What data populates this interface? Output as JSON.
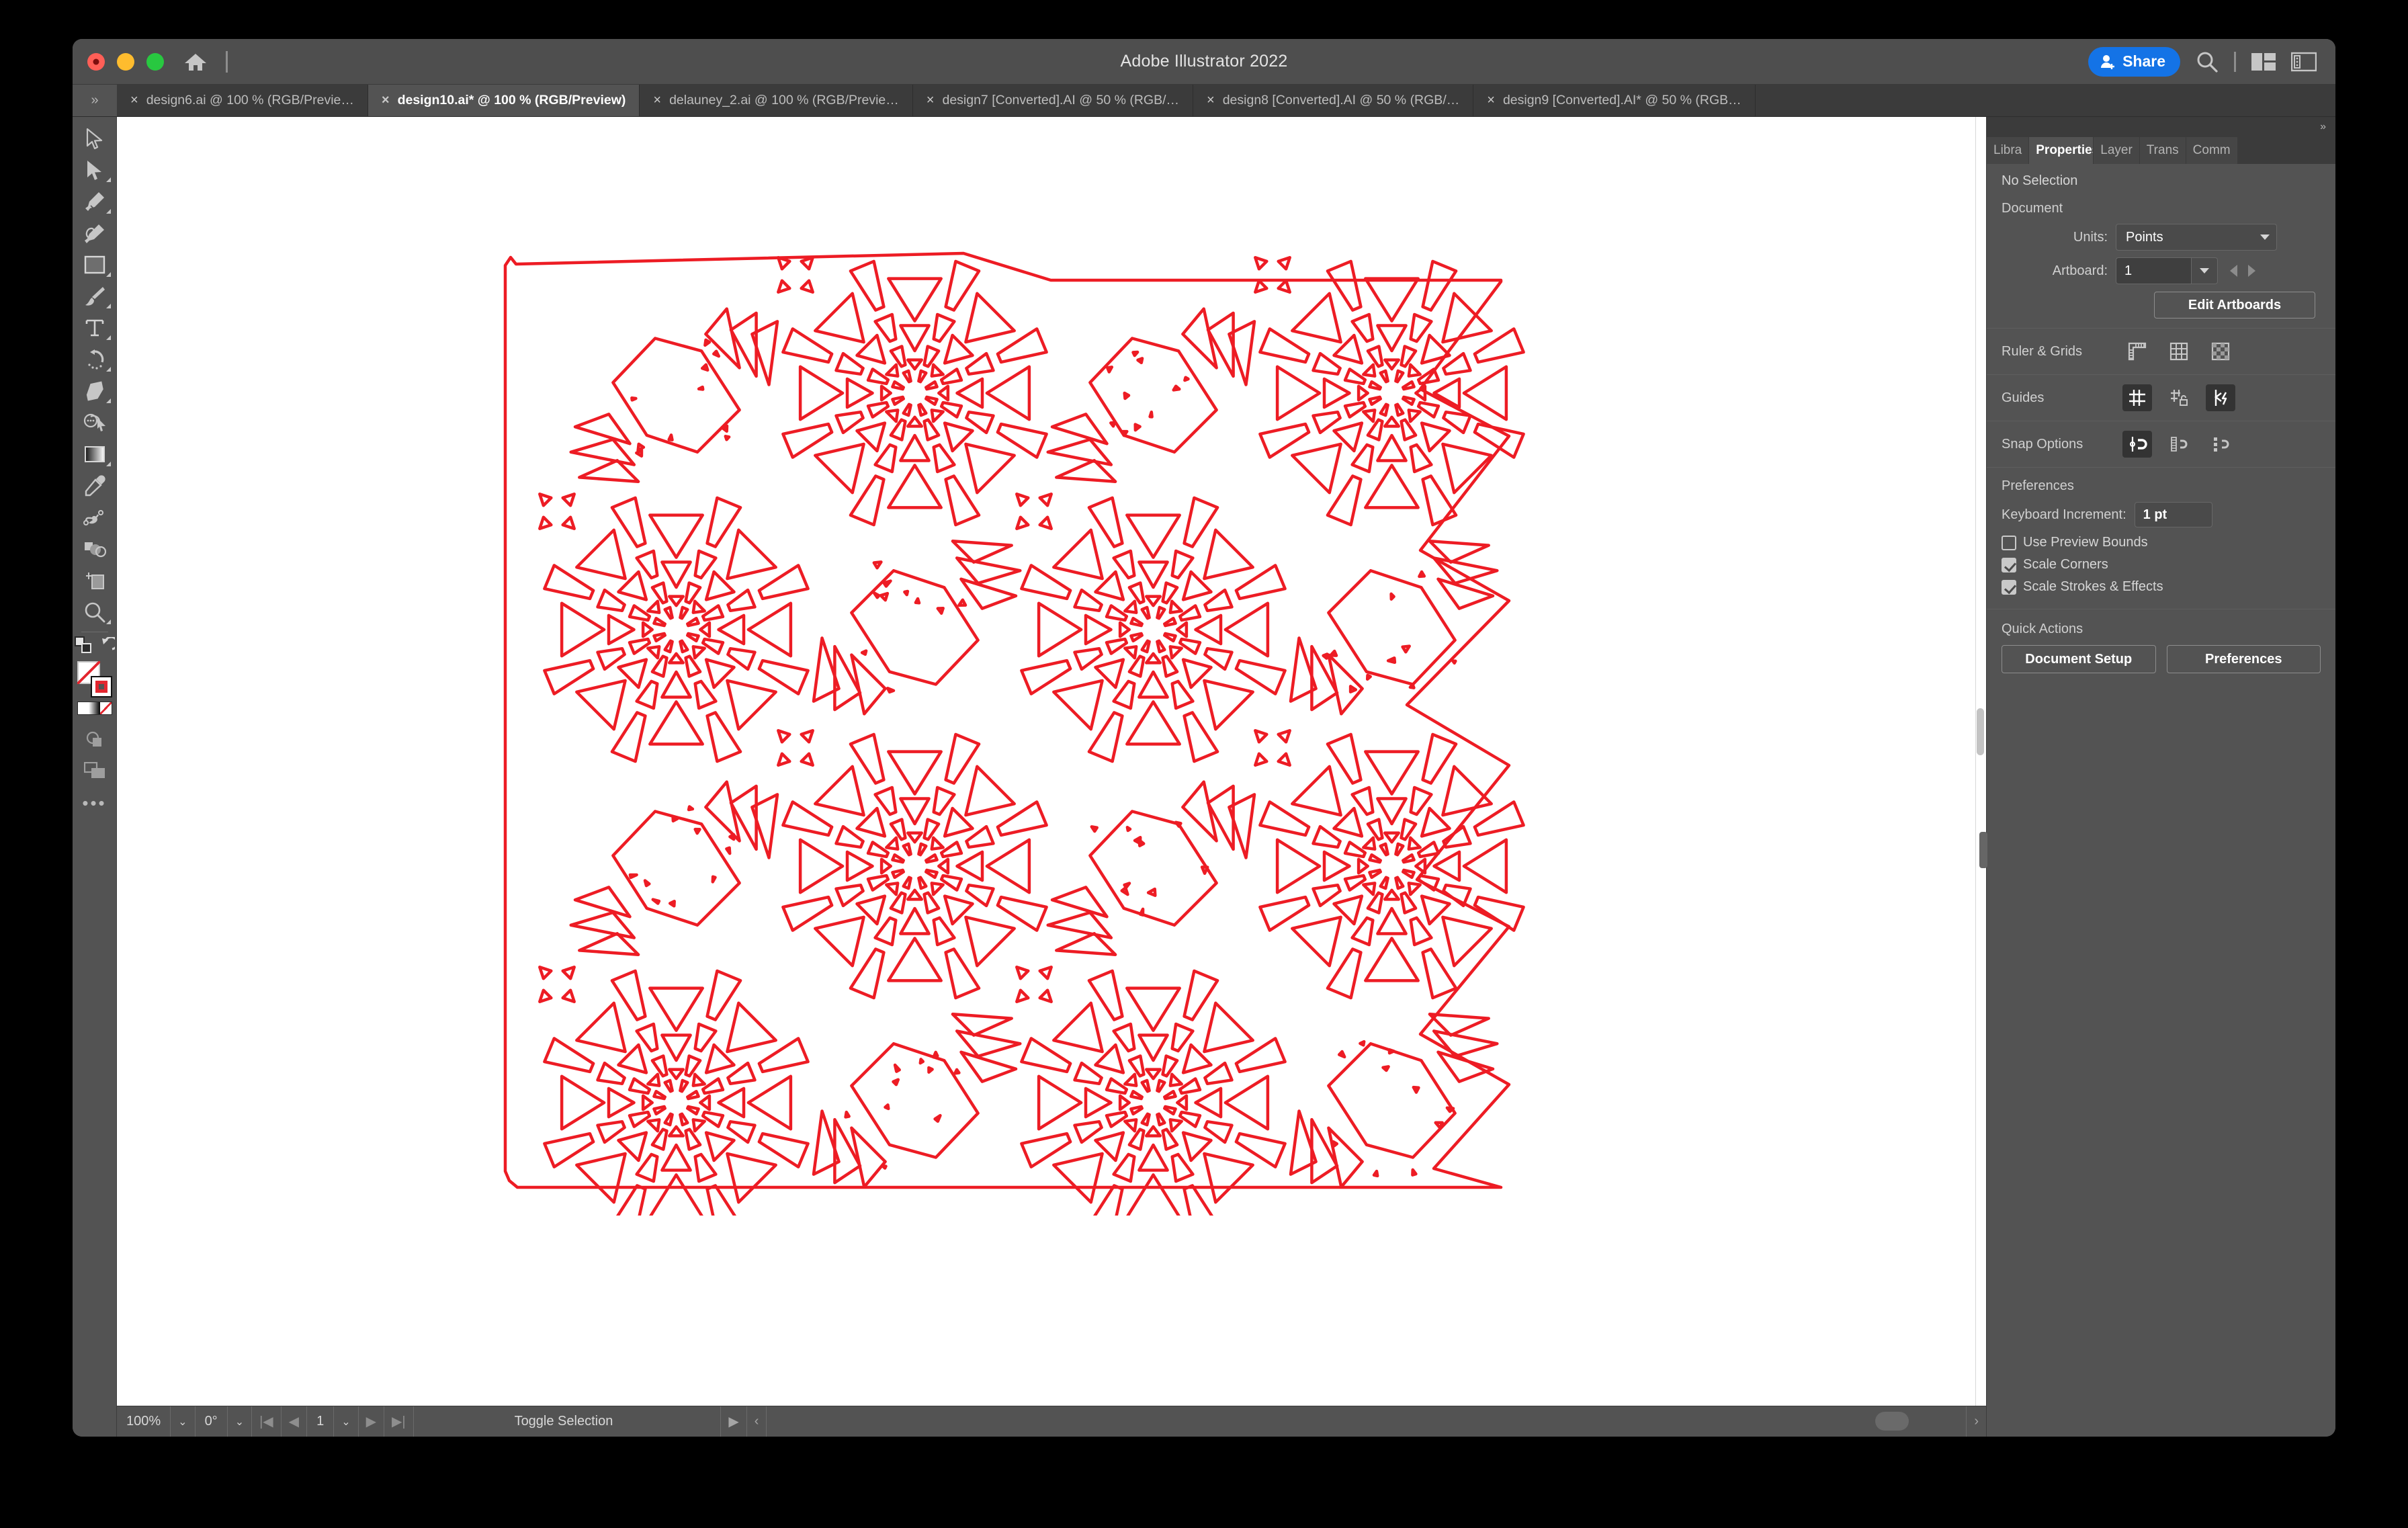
{
  "window": {
    "app_title": "Adobe Illustrator 2022",
    "traffic_lights": [
      "close",
      "minimize",
      "zoom"
    ],
    "home_icon": "home-icon",
    "share_label": "Share",
    "search_icon": "search-icon",
    "arrange_icon": "arrange-documents-icon",
    "workspace_icon": "workspace-switcher-icon"
  },
  "tabbar": {
    "overflow_left": "»",
    "tabs": [
      {
        "label": "design6.ai @ 100 % (RGB/Previe…",
        "close": "×",
        "active": false
      },
      {
        "label": "design10.ai* @ 100 % (RGB/Preview)",
        "close": "×",
        "active": true
      },
      {
        "label": "delauney_2.ai @ 100 % (RGB/Previe…",
        "close": "×",
        "active": false
      },
      {
        "label": "design7 [Converted].AI @ 50 % (RGB/…",
        "close": "×",
        "active": false
      },
      {
        "label": "design8 [Converted].AI @ 50 % (RGB/…",
        "close": "×",
        "active": false
      },
      {
        "label": "design9 [Converted].AI* @ 50 % (RGB…",
        "close": "×",
        "active": false
      }
    ]
  },
  "toolbar": {
    "tools": [
      {
        "name": "selection-tool",
        "more": false
      },
      {
        "name": "direct-selection-tool",
        "more": true
      },
      {
        "name": "pen-tool",
        "more": true
      },
      {
        "name": "curvature-tool",
        "more": false
      },
      {
        "name": "rectangle-tool",
        "more": true
      },
      {
        "name": "paintbrush-tool",
        "more": true
      },
      {
        "name": "type-tool",
        "more": true
      },
      {
        "name": "rotate-tool",
        "more": true
      },
      {
        "name": "eraser-tool",
        "more": true
      },
      {
        "name": "shape-builder-tool",
        "more": false
      },
      {
        "name": "gradient-tool",
        "more": true
      },
      {
        "name": "eyedropper-tool",
        "more": false
      },
      {
        "name": "blend-tool",
        "more": false
      },
      {
        "name": "symbol-sprayer-tool",
        "more": false
      },
      {
        "name": "artboard-tool",
        "more": false
      },
      {
        "name": "zoom-tool",
        "more": true
      }
    ],
    "swap_fill_stroke_icon": "swap-fill-stroke-icon",
    "default_fill_stroke_icon": "default-fill-stroke-icon",
    "fill_value": "none",
    "stroke_value": "#ed1c24",
    "color_mode_icons": [
      "color-swatch",
      "gradient-swatch",
      "none-swatch"
    ],
    "draw_mode_icon": "draw-normal-icon",
    "screen_mode_icon": "screen-mode-icon",
    "edit_toolbar_icon": "edit-toolbar-ellipsis"
  },
  "statusbar": {
    "zoom": "100%",
    "rotation": "0°",
    "artboard_number": "1",
    "status_text": "Toggle Selection",
    "first_icon": "first-artboard-icon",
    "prev_icon": "previous-artboard-icon",
    "next_icon": "next-artboard-icon",
    "last_icon": "last-artboard-icon",
    "play_icon": "play-icon",
    "collapse_icon": "collapse-icon"
  },
  "panel": {
    "overflow_icon": "»",
    "tabs": [
      {
        "label": "Libra",
        "active": false
      },
      {
        "label": "Properties",
        "active": true
      },
      {
        "label": "Layer",
        "active": false
      },
      {
        "label": "Trans",
        "active": false
      },
      {
        "label": "Comm",
        "active": false
      }
    ],
    "selection_state": "No Selection",
    "document": {
      "heading": "Document",
      "units_label": "Units:",
      "units_value": "Points",
      "artboard_label": "Artboard:",
      "artboard_value": "1",
      "edit_artboards_label": "Edit Artboards"
    },
    "ruler_grids": {
      "label": "Ruler & Grids",
      "icons": [
        "show-rulers-icon",
        "show-grid-icon",
        "show-transparency-grid-icon"
      ]
    },
    "guides": {
      "label": "Guides",
      "icons": [
        "show-guides-icon",
        "lock-guides-icon",
        "smart-guides-icon"
      ],
      "active": [
        true,
        false,
        true
      ]
    },
    "snap_options": {
      "label": "Snap Options",
      "icons": [
        "snap-to-point-icon",
        "snap-to-grid-icon",
        "snap-to-pixel-icon"
      ],
      "active": [
        true,
        false,
        false
      ]
    },
    "preferences": {
      "heading": "Preferences",
      "keyboard_increment_label": "Keyboard Increment:",
      "keyboard_increment_value": "1 pt",
      "checkboxes": [
        {
          "label": "Use Preview Bounds",
          "checked": false
        },
        {
          "label": "Scale Corners",
          "checked": true
        },
        {
          "label": "Scale Strokes & Effects",
          "checked": true
        }
      ]
    },
    "quick_actions": {
      "heading": "Quick Actions",
      "buttons": [
        "Document Setup",
        "Preferences"
      ]
    }
  },
  "artwork": {
    "name": "geometric-kaleidoscope-pattern",
    "stroke_color": "#ed1c24",
    "fill": "none",
    "description": "Red outlined tessellated kaleidoscopic pattern of radial starbursts, fan wedges and triangles with a sawtooth right edge"
  }
}
